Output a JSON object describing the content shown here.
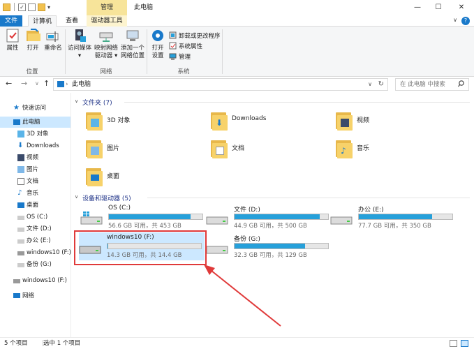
{
  "window": {
    "contextual_tab": "管理",
    "title": "此电脑",
    "minimize_glyph": "—",
    "maximize_glyph": "☐",
    "close_glyph": "✕"
  },
  "tabs": {
    "file": "文件",
    "computer": "计算机",
    "view": "查看",
    "drive_tools": "驱动器工具",
    "collapse_glyph": "∨",
    "help_glyph": "?"
  },
  "ribbon": {
    "groups": {
      "location": "位置",
      "network": "网络",
      "system": "系统"
    },
    "buttons": {
      "properties": "属性",
      "open": "打开",
      "rename": "重命名",
      "access_media_1": "访问媒体",
      "access_media_2": "▾",
      "map_drive_1": "映射网络",
      "map_drive_2": "驱动器 ▾",
      "add_location_1": "添加一个",
      "add_location_2": "网络位置",
      "open_settings_1": "打开",
      "open_settings_2": "设置",
      "uninstall": "卸载或更改程序",
      "system_props": "系统属性",
      "manage": "管理"
    }
  },
  "address": {
    "back_glyph": "←",
    "forward_glyph": "→",
    "recent_glyph": "∨",
    "up_glyph": "↑",
    "path_sep": "›",
    "path": "此电脑",
    "dropdown_glyph": "∨",
    "refresh_glyph": "↻",
    "search_placeholder": "在 此电脑 中搜索"
  },
  "nav": {
    "items": [
      {
        "label": "快速访问",
        "icon": "star-icon"
      },
      {
        "label": "此电脑",
        "icon": "computer-icon"
      },
      {
        "label": "3D 对象",
        "icon": "3d-objects-icon"
      },
      {
        "label": "Downloads",
        "icon": "downloads-icon"
      },
      {
        "label": "视频",
        "icon": "video-icon"
      },
      {
        "label": "图片",
        "icon": "pictures-icon"
      },
      {
        "label": "文档",
        "icon": "documents-icon"
      },
      {
        "label": "音乐",
        "icon": "music-icon"
      },
      {
        "label": "桌面",
        "icon": "desktop-icon"
      },
      {
        "label": "OS (C:)",
        "icon": "drive-icon"
      },
      {
        "label": "文件 (D:)",
        "icon": "drive-icon"
      },
      {
        "label": "办公 (E:)",
        "icon": "drive-icon"
      },
      {
        "label": "windows10 (F:)",
        "icon": "usb-drive-icon"
      },
      {
        "label": "备份 (G:)",
        "icon": "drive-icon"
      },
      {
        "label": "windows10 (F:)",
        "icon": "usb-drive-icon"
      },
      {
        "label": "网络",
        "icon": "network-icon"
      }
    ]
  },
  "content": {
    "folders_header": "文件夹 (7)",
    "devices_header": "设备和驱动器 (5)",
    "folders": [
      {
        "name": "3D 对象",
        "icon": "3d-objects-folder-icon"
      },
      {
        "name": "Downloads",
        "icon": "downloads-folder-icon"
      },
      {
        "name": "视频",
        "icon": "video-folder-icon"
      },
      {
        "name": "图片",
        "icon": "pictures-folder-icon"
      },
      {
        "name": "文档",
        "icon": "documents-folder-icon"
      },
      {
        "name": "音乐",
        "icon": "music-folder-icon"
      },
      {
        "name": "桌面",
        "icon": "desktop-folder-icon"
      }
    ],
    "drives": [
      {
        "name": "OS (C:)",
        "size": "56.6 GB 可用，共 453 GB",
        "used_fraction": 0.875,
        "icon": "windows-drive-icon"
      },
      {
        "name": "文件 (D:)",
        "size": "44.9 GB 可用，共 500 GB",
        "used_fraction": 0.91,
        "icon": "drive-icon"
      },
      {
        "name": "办公 (E:)",
        "size": "77.7 GB 可用，共 350 GB",
        "used_fraction": 0.78,
        "icon": "drive-icon"
      },
      {
        "name": "windows10 (F:)",
        "size": "14.3 GB 可用，共 14.4 GB",
        "used_fraction": 0.01,
        "icon": "usb-drive-icon"
      },
      {
        "name": "备份 (G:)",
        "size": "32.3 GB 可用，共 129 GB",
        "used_fraction": 0.75,
        "icon": "drive-icon"
      }
    ]
  },
  "status": {
    "count": "5 个项目",
    "selected": "选中 1 个项目"
  },
  "colors": {
    "accent": "#1979ca",
    "selection": "#cce8ff",
    "bar_fill": "#26a0da",
    "annotation": "#e03a3a"
  }
}
